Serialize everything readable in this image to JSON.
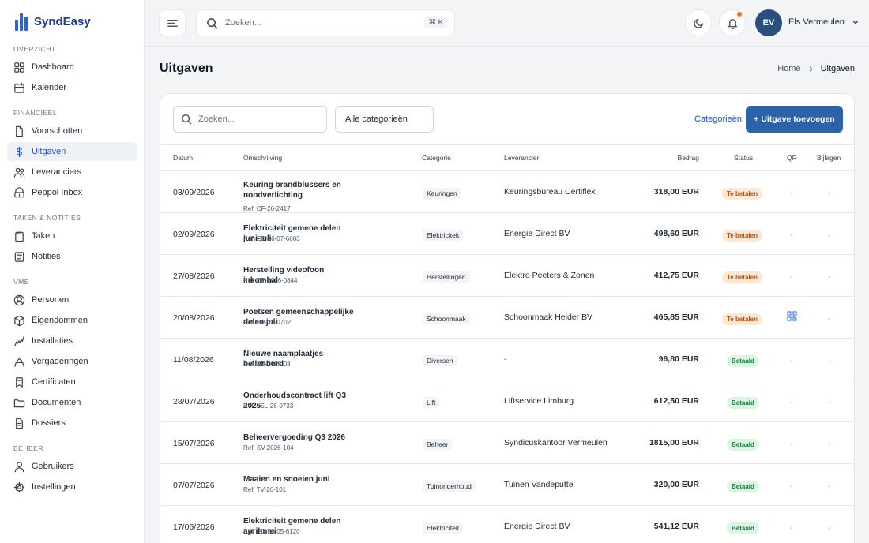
{
  "app": {
    "name": "SyndEasy"
  },
  "sidebar": {
    "sections": [
      {
        "label": "OVERZICHT",
        "items": [
          {
            "label": "Dashboard",
            "icon": "dashboard-icon"
          },
          {
            "label": "Kalender",
            "icon": "calendar-icon"
          }
        ]
      },
      {
        "label": "FINANCIEEL",
        "items": [
          {
            "label": "Voorschotten",
            "icon": "document-icon"
          },
          {
            "label": "Uitgaven",
            "icon": "dollar-icon",
            "active": true
          },
          {
            "label": "Leveranciers",
            "icon": "users-icon"
          },
          {
            "label": "Peppol Inbox",
            "icon": "inbox-icon"
          }
        ]
      },
      {
        "label": "TAKEN & NOTITIES",
        "items": [
          {
            "label": "Taken",
            "icon": "clipboard-icon"
          },
          {
            "label": "Notities",
            "icon": "note-icon"
          }
        ]
      },
      {
        "label": "VME",
        "items": [
          {
            "label": "Personen",
            "icon": "person-icon"
          },
          {
            "label": "Eigendommen",
            "icon": "box-icon"
          },
          {
            "label": "Installaties",
            "icon": "wrench-icon"
          },
          {
            "label": "Vergaderingen",
            "icon": "meeting-icon"
          },
          {
            "label": "Certificaten",
            "icon": "certificate-icon"
          },
          {
            "label": "Documenten",
            "icon": "folder-icon"
          },
          {
            "label": "Dossiers",
            "icon": "file-icon"
          }
        ]
      },
      {
        "label": "BEHEER",
        "items": [
          {
            "label": "Gebruikers",
            "icon": "user-icon"
          },
          {
            "label": "Instellingen",
            "icon": "settings-icon"
          }
        ]
      }
    ]
  },
  "topbar": {
    "search_placeholder": "Zoeken...",
    "shortcut": "⌘ K",
    "user_initials": "EV",
    "user_name": "Els Vermeulen"
  },
  "page": {
    "title": "Uitgaven",
    "breadcrumb_home": "Home",
    "breadcrumb_current": "Uitgaven"
  },
  "toolbar": {
    "search_placeholder": "Zoeken...",
    "category_filter": "Alle categorieën",
    "categories_link": "Categorieën",
    "add_button": "+ Uitgave toevoegen"
  },
  "table": {
    "headers": {
      "date": "Datum",
      "description": "Omschrijving",
      "category": "Categorie",
      "supplier": "Leverancier",
      "amount": "Bedrag",
      "status": "Status",
      "qr": "QR",
      "attachments": "Bijlagen"
    },
    "rows": [
      {
        "date": "03/09/2026",
        "title": "Keuring brandblussers en noodverlichting",
        "ref": "Ref: CF-26-2417",
        "category": "Keuringen",
        "supplier": "Keuringsbureau Certiflex",
        "amount": "318,00 EUR",
        "status": "Te betalen",
        "status_type": "due",
        "qr": "-",
        "attachments": "-"
      },
      {
        "date": "02/09/2026",
        "title": "Elektriciteit gemene delen juni-juli",
        "ref": "Ref: ED-26-07-6603",
        "category": "Elektriciteit",
        "supplier": "Energie Direct BV",
        "amount": "498,60 EUR",
        "status": "Te betalen",
        "status_type": "due",
        "qr": "-",
        "attachments": "-"
      },
      {
        "date": "27/08/2026",
        "title": "Herstelling videofoon inkomhal",
        "ref": "Ref: EP-2026-0844",
        "category": "Herstellingen",
        "supplier": "Elektro Peeters & Zonen",
        "amount": "412,75 EUR",
        "status": "Te betalen",
        "status_type": "due",
        "qr": "-",
        "attachments": "-"
      },
      {
        "date": "20/08/2026",
        "title": "Poetsen gemeenschappelijke delen juli",
        "ref": "Ref: HB-26-0702",
        "category": "Schoonmaak",
        "supplier": "Schoonmaak Helder BV",
        "amount": "465,85 EUR",
        "status": "Te betalen",
        "status_type": "due",
        "qr": "qr-icon",
        "attachments": "-"
      },
      {
        "date": "11/08/2026",
        "title": "Nieuwe naamplaatjes bellenbord",
        "ref": "Ref: KB-2026-08",
        "category": "Diversen",
        "supplier": "-",
        "amount": "96,80 EUR",
        "status": "Betaald",
        "status_type": "paid",
        "qr": "-",
        "attachments": "-"
      },
      {
        "date": "28/07/2026",
        "title": "Onderhoudscontract lift Q3 2026",
        "ref": "Ref: LSL-26-0733",
        "category": "Lift",
        "supplier": "Liftservice Limburg",
        "amount": "612,50 EUR",
        "status": "Betaald",
        "status_type": "paid",
        "qr": "-",
        "attachments": "-"
      },
      {
        "date": "15/07/2026",
        "title": "Beheervergoeding Q3 2026",
        "ref": "Ref: SV-2026-104",
        "category": "Beheer",
        "supplier": "Syndicuskantoor Vermeulen",
        "amount": "1815,00 EUR",
        "status": "Betaald",
        "status_type": "paid",
        "qr": "-",
        "attachments": "-"
      },
      {
        "date": "07/07/2026",
        "title": "Maaien en snoeien juni",
        "ref": "Ref: TV-26-101",
        "category": "Tuinonderhoud",
        "supplier": "Tuinen Vandeputte",
        "amount": "320,00 EUR",
        "status": "Betaald",
        "status_type": "paid",
        "qr": "-",
        "attachments": "-"
      },
      {
        "date": "17/06/2026",
        "title": "Elektriciteit gemene delen april-mei",
        "ref": "Ref: ED-26-05-6120",
        "category": "Elektriciteit",
        "supplier": "Energie Direct BV",
        "amount": "541,12 EUR",
        "status": "Betaald",
        "status_type": "paid",
        "qr": "-",
        "attachments": "-"
      }
    ]
  },
  "colors": {
    "accent": "#2b62a8",
    "due_bg": "#fde8d7",
    "due_text": "#b45309",
    "paid_bg": "#dcf5e3",
    "paid_text": "#15803d"
  }
}
